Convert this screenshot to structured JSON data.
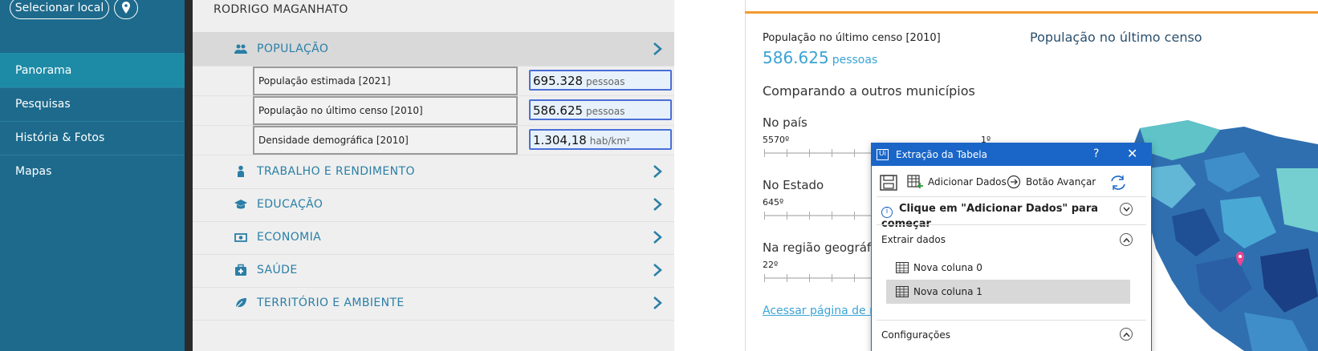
{
  "sidebar": {
    "select_label": "Selecionar local",
    "nav": [
      "Panorama",
      "Pesquisas",
      "História & Fotos",
      "Mapas"
    ]
  },
  "middle": {
    "person": "RODRIGO MAGANHATO",
    "sections": [
      {
        "label": "POPULAÇÃO",
        "icon": "people-icon"
      },
      {
        "label": "TRABALHO E RENDIMENTO",
        "icon": "worker-icon"
      },
      {
        "label": "EDUCAÇÃO",
        "icon": "graduation-cap-icon"
      },
      {
        "label": "ECONOMIA",
        "icon": "money-icon"
      },
      {
        "label": "SAÚDE",
        "icon": "first-aid-icon"
      },
      {
        "label": "TERRITÓRIO E AMBIENTE",
        "icon": "leaf-icon"
      }
    ],
    "rows": [
      {
        "label": "População estimada [2021]",
        "value": "695.328",
        "unit": "pessoas"
      },
      {
        "label": "População no último censo [2010]",
        "value": "586.625",
        "unit": "pessoas"
      },
      {
        "label": "Densidade demográfica [2010]",
        "value": "1.304,18",
        "unit": "hab/km²"
      }
    ]
  },
  "right": {
    "title_small": "População no último censo [2010]",
    "big_value": "586.625",
    "big_unit": "pessoas",
    "title_right": "População no último censo",
    "compare": "Comparando a outros municípios",
    "country_label": "No país",
    "country_rank": "5570º",
    "country_rank_right": "1º",
    "state_label": "No Estado",
    "state_rank": "645º",
    "region_label": "Na região geográfica",
    "region_rank": "22º",
    "link": "Acessar página de ranking"
  },
  "dialog": {
    "title": "Extração da Tabela",
    "help": "?",
    "close": "✕",
    "add_data": "Adicionar Dados",
    "next_button": "Botão Avançar",
    "info_text": "Clique em \"Adicionar Dados\" para começar",
    "extract_title": "Extrair dados",
    "columns": [
      "Nova coluna 0",
      "Nova coluna 1"
    ],
    "config": "Configurações",
    "accent": "#1a66c8"
  }
}
